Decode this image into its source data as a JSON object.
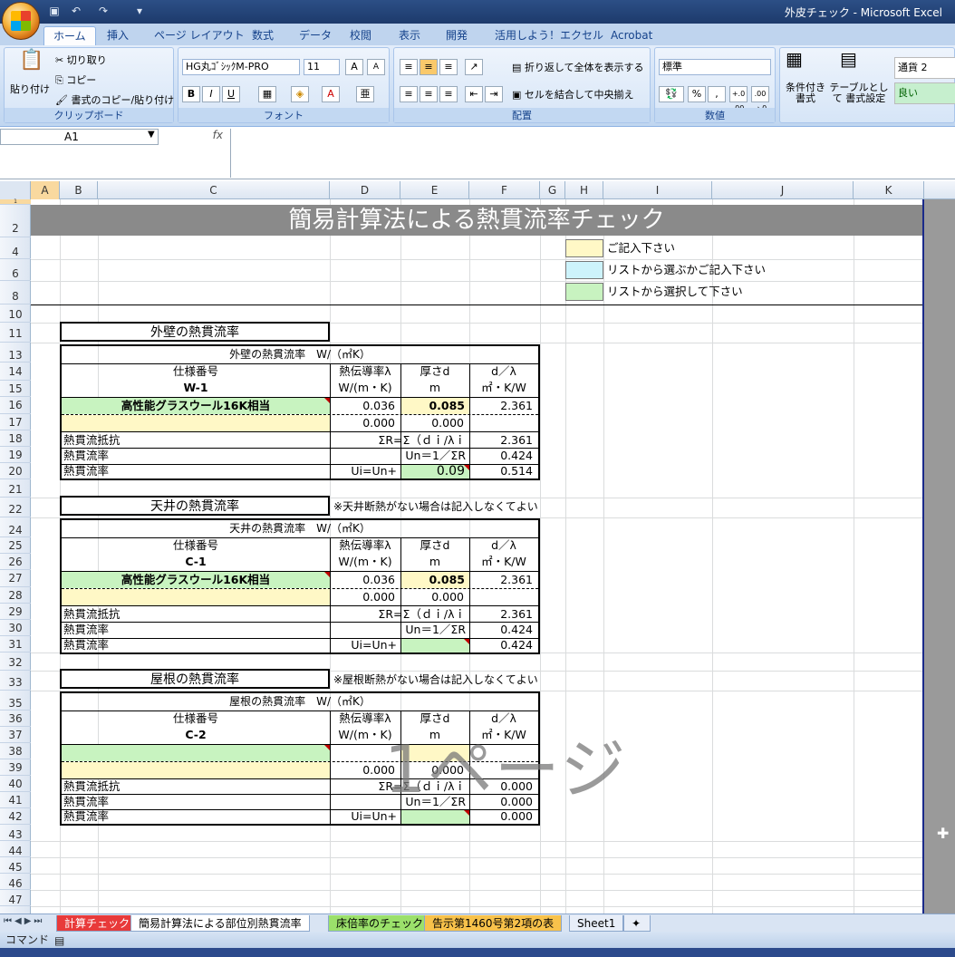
{
  "window": {
    "title": "外皮チェック - Microsoft Excel"
  },
  "ribbon_tabs": [
    "ホーム",
    "挿入",
    "ページ レイアウト",
    "数式",
    "データ",
    "校閲",
    "表示",
    "開発",
    "活用しよう！エクセル",
    "Acrobat"
  ],
  "ribbon": {
    "clipboard": {
      "paste": "貼り付け",
      "cut": "切り取り",
      "copy": "コピー",
      "format_painter": "書式のコピー/貼り付け",
      "label": "クリップボード"
    },
    "font": {
      "name": "HG丸ｺﾞｼｯｸM-PRO",
      "size": "11",
      "label": "フォント",
      "bold": "B",
      "italic": "I",
      "underline": "U",
      "grow": "A",
      "shrink": "A"
    },
    "alignment": {
      "wrap": "折り返して全体を表示する",
      "merge": "セルを結合して中央揃え",
      "label": "配置"
    },
    "number": {
      "format": "標準",
      "percent": "%",
      "comma": ",",
      "inc": "+.0 .00",
      "dec": ".00 →.0",
      "label": "数値"
    },
    "styles": {
      "conditional": "条件付き 書式",
      "table": "テーブルとして 書式設定",
      "style1": "通貨 2",
      "style2": "良い"
    }
  },
  "formula_bar": {
    "name_box": "A1",
    "fx": "fx",
    "value": ""
  },
  "columns": [
    "A",
    "B",
    "C",
    "D",
    "E",
    "F",
    "G",
    "H",
    "I",
    "J",
    "K"
  ],
  "rows": [
    "1",
    "2",
    "4",
    "6",
    "8",
    "10",
    "11",
    "13",
    "14",
    "15",
    "16",
    "17",
    "18",
    "19",
    "20",
    "21",
    "22",
    "24",
    "25",
    "26",
    "27",
    "28",
    "29",
    "30",
    "31",
    "32",
    "33",
    "35",
    "36",
    "37",
    "38",
    "39",
    "40",
    "41",
    "42",
    "43",
    "44",
    "45",
    "46",
    "47"
  ],
  "banner": "簡易計算法による熱貫流率チェック",
  "legend": [
    {
      "text": "ご記入下さい",
      "color": "#fff8c6"
    },
    {
      "text": "リストから選ぶかご記入下さい",
      "color": "#cdf3fb"
    },
    {
      "text": "リストから選択して下さい",
      "color": "#c8f3c0"
    }
  ],
  "sections": [
    {
      "title": "外壁の熱貫流率",
      "note": "",
      "subtitle": "外壁の熱貫流率　W/（㎡K）",
      "hdr": {
        "spec": "仕様番号",
        "code": "W-1",
        "lambda": "熱伝導率λ",
        "lambda_u": "W/(m・K)",
        "d": "厚さd",
        "d_u": "m",
        "dl": "d／λ",
        "dl_u": "㎡・K/W"
      },
      "row1": {
        "name": "高性能グラスウール16K相当",
        "lambda": "0.036",
        "d": "0.085",
        "dl": "2.361"
      },
      "row2": {
        "name": "",
        "lambda": "0.000",
        "d": "0.000",
        "dl": ""
      },
      "r_label": "熱貫流抵抗",
      "r_formula": "ΣR=Σ（ｄｉ/λｉ",
      "r_val": "2.361",
      "u_label": "熱貫流率",
      "u_formula": "Un＝1／ΣR",
      "u_val": "0.424",
      "ui_label": "熱貫流率",
      "ui_formula": "Ui=Un+",
      "ui_add": "0.09",
      "ui_val": "0.514"
    },
    {
      "title": "天井の熱貫流率",
      "note": "※天井断熱がない場合は記入しなくてよい",
      "subtitle": "天井の熱貫流率　W/（㎡K）",
      "hdr": {
        "spec": "仕様番号",
        "code": "C-1",
        "lambda": "熱伝導率λ",
        "lambda_u": "W/(m・K)",
        "d": "厚さd",
        "d_u": "m",
        "dl": "d／λ",
        "dl_u": "㎡・K/W"
      },
      "row1": {
        "name": "高性能グラスウール16K相当",
        "lambda": "0.036",
        "d": "0.085",
        "dl": "2.361"
      },
      "row2": {
        "name": "",
        "lambda": "0.000",
        "d": "0.000",
        "dl": ""
      },
      "r_label": "熱貫流抵抗",
      "r_formula": "ΣR=Σ（ｄｉ/λｉ",
      "r_val": "2.361",
      "u_label": "熱貫流率",
      "u_formula": "Un＝1／ΣR",
      "u_val": "0.424",
      "ui_label": "熱貫流率",
      "ui_formula": "Ui=Un+",
      "ui_add": "",
      "ui_val": "0.424"
    },
    {
      "title": "屋根の熱貫流率",
      "note": "※屋根断熱がない場合は記入しなくてよい",
      "subtitle": "屋根の熱貫流率　W/（㎡K）",
      "hdr": {
        "spec": "仕様番号",
        "code": "C-2",
        "lambda": "熱伝導率λ",
        "lambda_u": "W/(m・K)",
        "d": "厚さd",
        "d_u": "m",
        "dl": "d／λ",
        "dl_u": "㎡・K/W"
      },
      "row1": {
        "name": "",
        "lambda": "",
        "d": "",
        "dl": ""
      },
      "row2": {
        "name": "",
        "lambda": "0.000",
        "d": "0.000",
        "dl": ""
      },
      "r_label": "熱貫流抵抗",
      "r_formula": "ΣR=Σ（ｄｉ/λｉ",
      "r_val": "0.000",
      "u_label": "熱貫流率",
      "u_formula": "Un＝1／ΣR",
      "u_val": "0.000",
      "ui_label": "熱貫流率",
      "ui_formula": "Ui=Un+",
      "ui_add": "",
      "ui_val": "0.000"
    }
  ],
  "watermark": "1ページ",
  "sheet_tabs": [
    "計算チェック",
    "簡易計算法による部位別熱貫流率",
    "床倍率のチェック",
    "告示第1460号第2項の表",
    "Sheet1"
  ],
  "status": "コマンド"
}
